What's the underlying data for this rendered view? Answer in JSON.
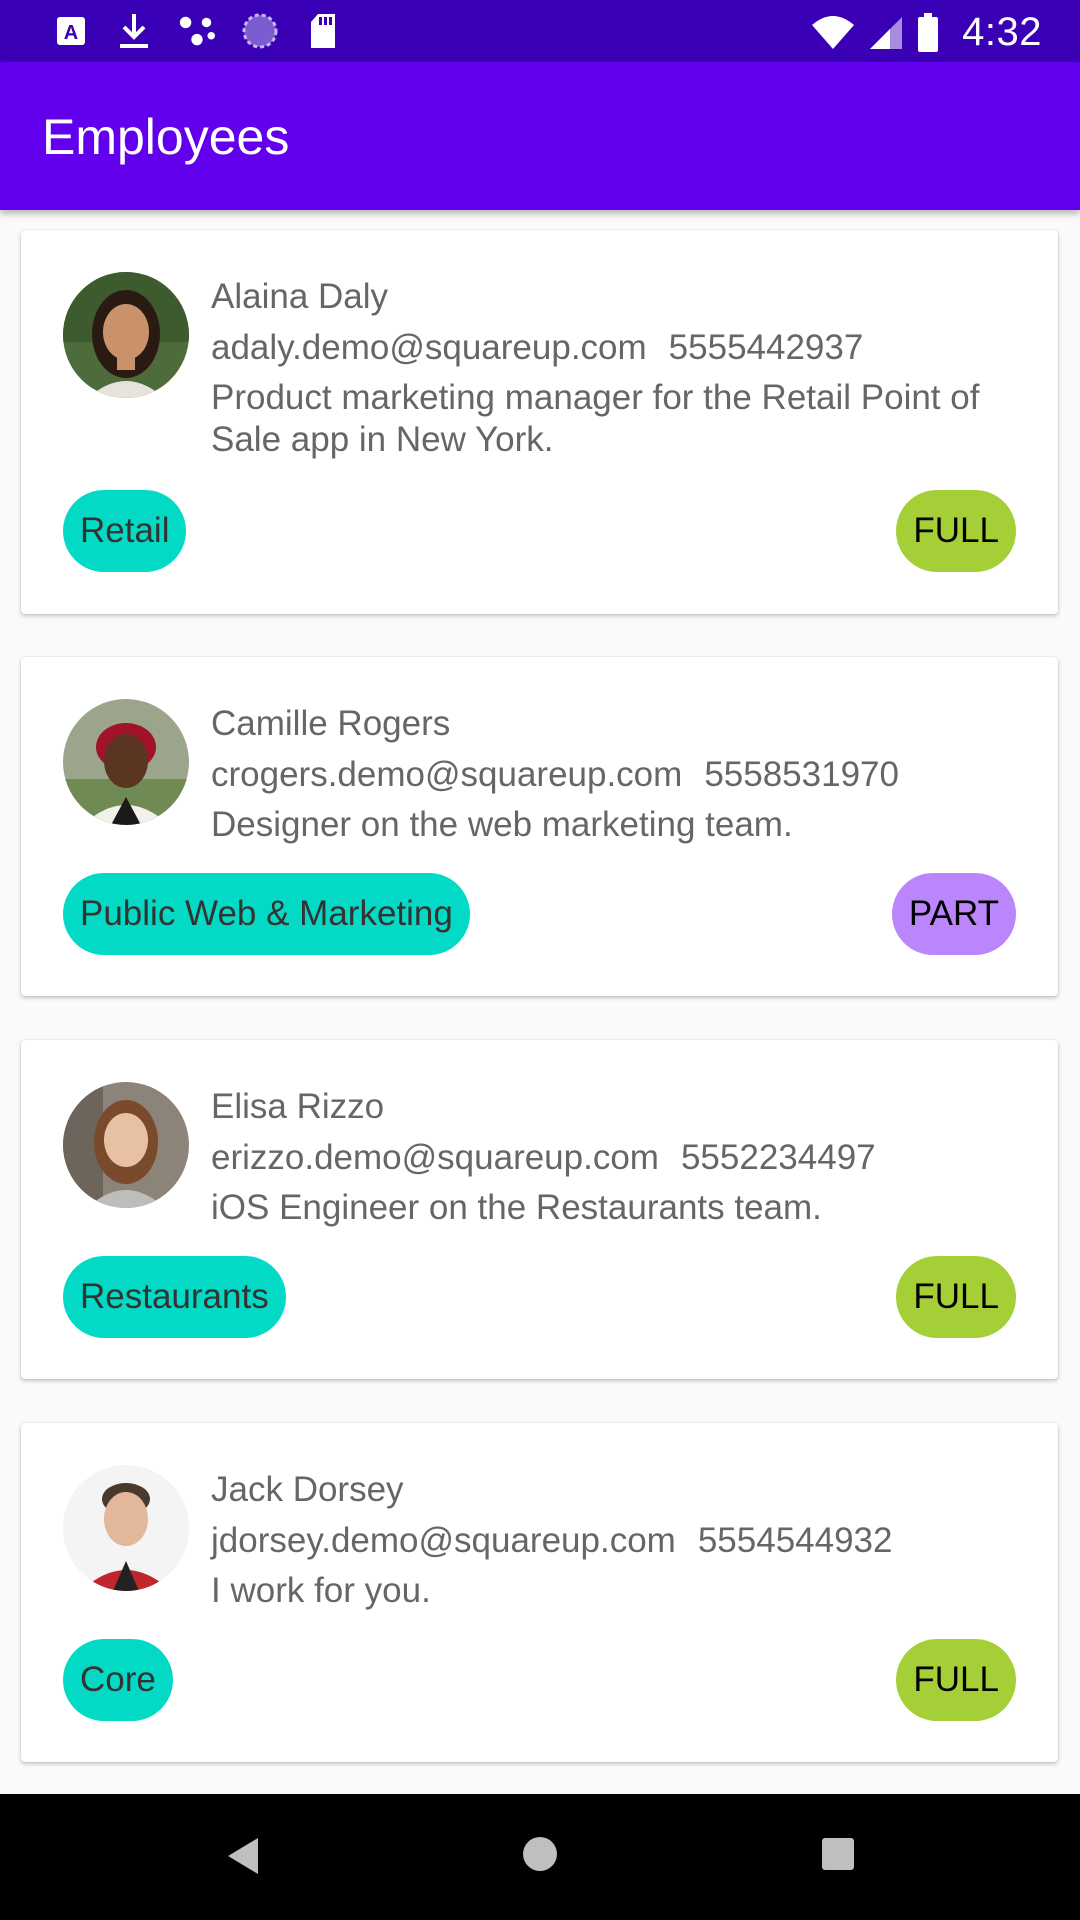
{
  "status_bar": {
    "time": "4:32",
    "left_icons": [
      "app-a-icon",
      "download-icon",
      "share-dots-icon",
      "sync-icon",
      "sd-card-icon"
    ],
    "right_icons": [
      "wifi-icon",
      "signal-icon",
      "battery-icon"
    ]
  },
  "app_bar": {
    "title": "Employees"
  },
  "employees": [
    {
      "name": "Alaina Daly",
      "email": "adaly.demo@squareup.com",
      "phone": "5555442937",
      "bio": "Product marketing manager for the Retail Point of Sale app in New York.",
      "team": "Retail",
      "type": "FULL"
    },
    {
      "name": "Camille Rogers",
      "email": "crogers.demo@squareup.com",
      "phone": "5558531970",
      "bio": "Designer on the web marketing team.",
      "team": "Public Web & Marketing",
      "type": "PART"
    },
    {
      "name": "Elisa Rizzo",
      "email": "erizzo.demo@squareup.com",
      "phone": "5552234497",
      "bio": "iOS Engineer on the Restaurants team.",
      "team": "Restaurants",
      "type": "FULL"
    },
    {
      "name": "Jack Dorsey",
      "email": "jdorsey.demo@squareup.com",
      "phone": "5554544932",
      "bio": "I work for you.",
      "team": "Core",
      "type": "FULL"
    }
  ],
  "colors": {
    "status_bar": "#3A00B5",
    "app_bar": "#6200EE",
    "team_chip": "#03DAC5",
    "full_chip": "#A4CF36",
    "part_chip": "#BB86FC"
  },
  "nav_bar": {
    "icons": [
      "back-icon",
      "home-icon",
      "recents-icon"
    ]
  }
}
